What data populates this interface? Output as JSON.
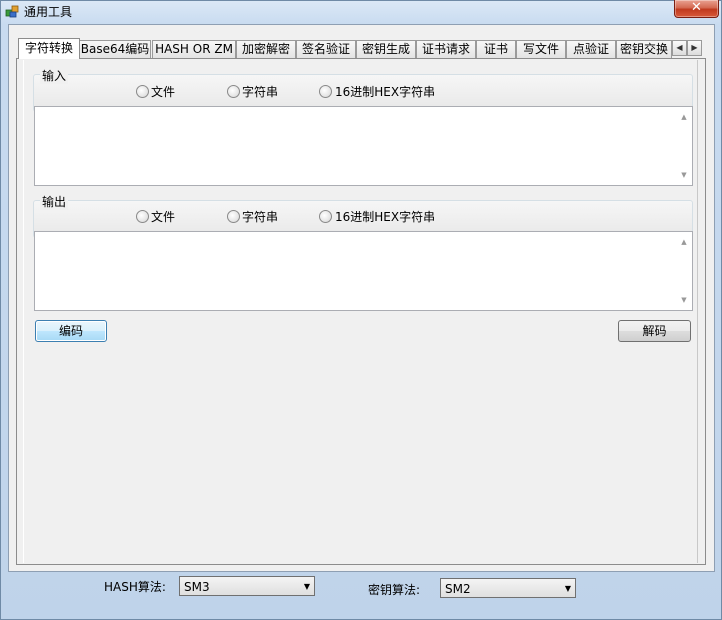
{
  "window": {
    "title": "通用工具",
    "close_label": "✕"
  },
  "tabs": [
    {
      "label": "字符转换",
      "active": true
    },
    {
      "label": "Base64编码"
    },
    {
      "label": "HASH OR ZM"
    },
    {
      "label": "加密解密"
    },
    {
      "label": "签名验证"
    },
    {
      "label": "密钥生成"
    },
    {
      "label": "证书请求"
    },
    {
      "label": "证书"
    },
    {
      "label": "写文件"
    },
    {
      "label": "点验证"
    },
    {
      "label": "密钥交换"
    }
  ],
  "tab_scroll": {
    "left": "◀",
    "right": "▶"
  },
  "input_group": {
    "title": "输入",
    "options": [
      "文件",
      "字符串",
      "16进制HEX字符串"
    ]
  },
  "output_group": {
    "title": "输出",
    "options": [
      "文件",
      "字符串",
      "16进制HEX字符串"
    ]
  },
  "input_text": "",
  "output_text": "",
  "buttons": {
    "encode": "编码",
    "decode": "解码"
  },
  "bottom": {
    "hash_label": "HASH算法:",
    "hash_value": "SM3",
    "key_label": "密钥算法:",
    "key_value": "SM2"
  }
}
